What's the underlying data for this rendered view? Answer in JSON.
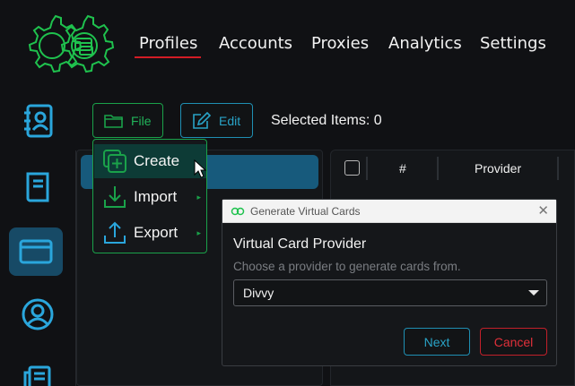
{
  "nav": {
    "items": [
      {
        "label": "Profiles"
      },
      {
        "label": "Accounts"
      },
      {
        "label": "Proxies"
      },
      {
        "label": "Analytics"
      },
      {
        "label": "Settings"
      }
    ],
    "active": "Profiles"
  },
  "sidebar": {
    "items": [
      {
        "icon": "address-book-icon"
      },
      {
        "icon": "book-icon"
      },
      {
        "icon": "credit-card-icon",
        "active": true
      },
      {
        "icon": "user-circle-icon"
      },
      {
        "icon": "newspaper-icon"
      }
    ]
  },
  "toolbar": {
    "file_label": "File",
    "edit_label": "Edit",
    "selected_items": "Selected Items: 0"
  },
  "file_menu": {
    "items": [
      {
        "label": "Create",
        "icon": "add-square-icon"
      },
      {
        "label": "Import",
        "icon": "download-icon"
      },
      {
        "label": "Export",
        "icon": "upload-icon"
      }
    ]
  },
  "table": {
    "columns": [
      "#",
      "Provider"
    ]
  },
  "dialog": {
    "title": "Generate Virtual Cards",
    "heading": "Virtual Card Provider",
    "subtitle": "Choose a provider to generate cards from.",
    "provider_value": "Divvy",
    "next_label": "Next",
    "cancel_label": "Cancel"
  },
  "colors": {
    "accent_green": "#1aa24a",
    "accent_blue": "#29a3c7",
    "accent_red": "#d21c25",
    "sidebar_active": "#174a66"
  }
}
